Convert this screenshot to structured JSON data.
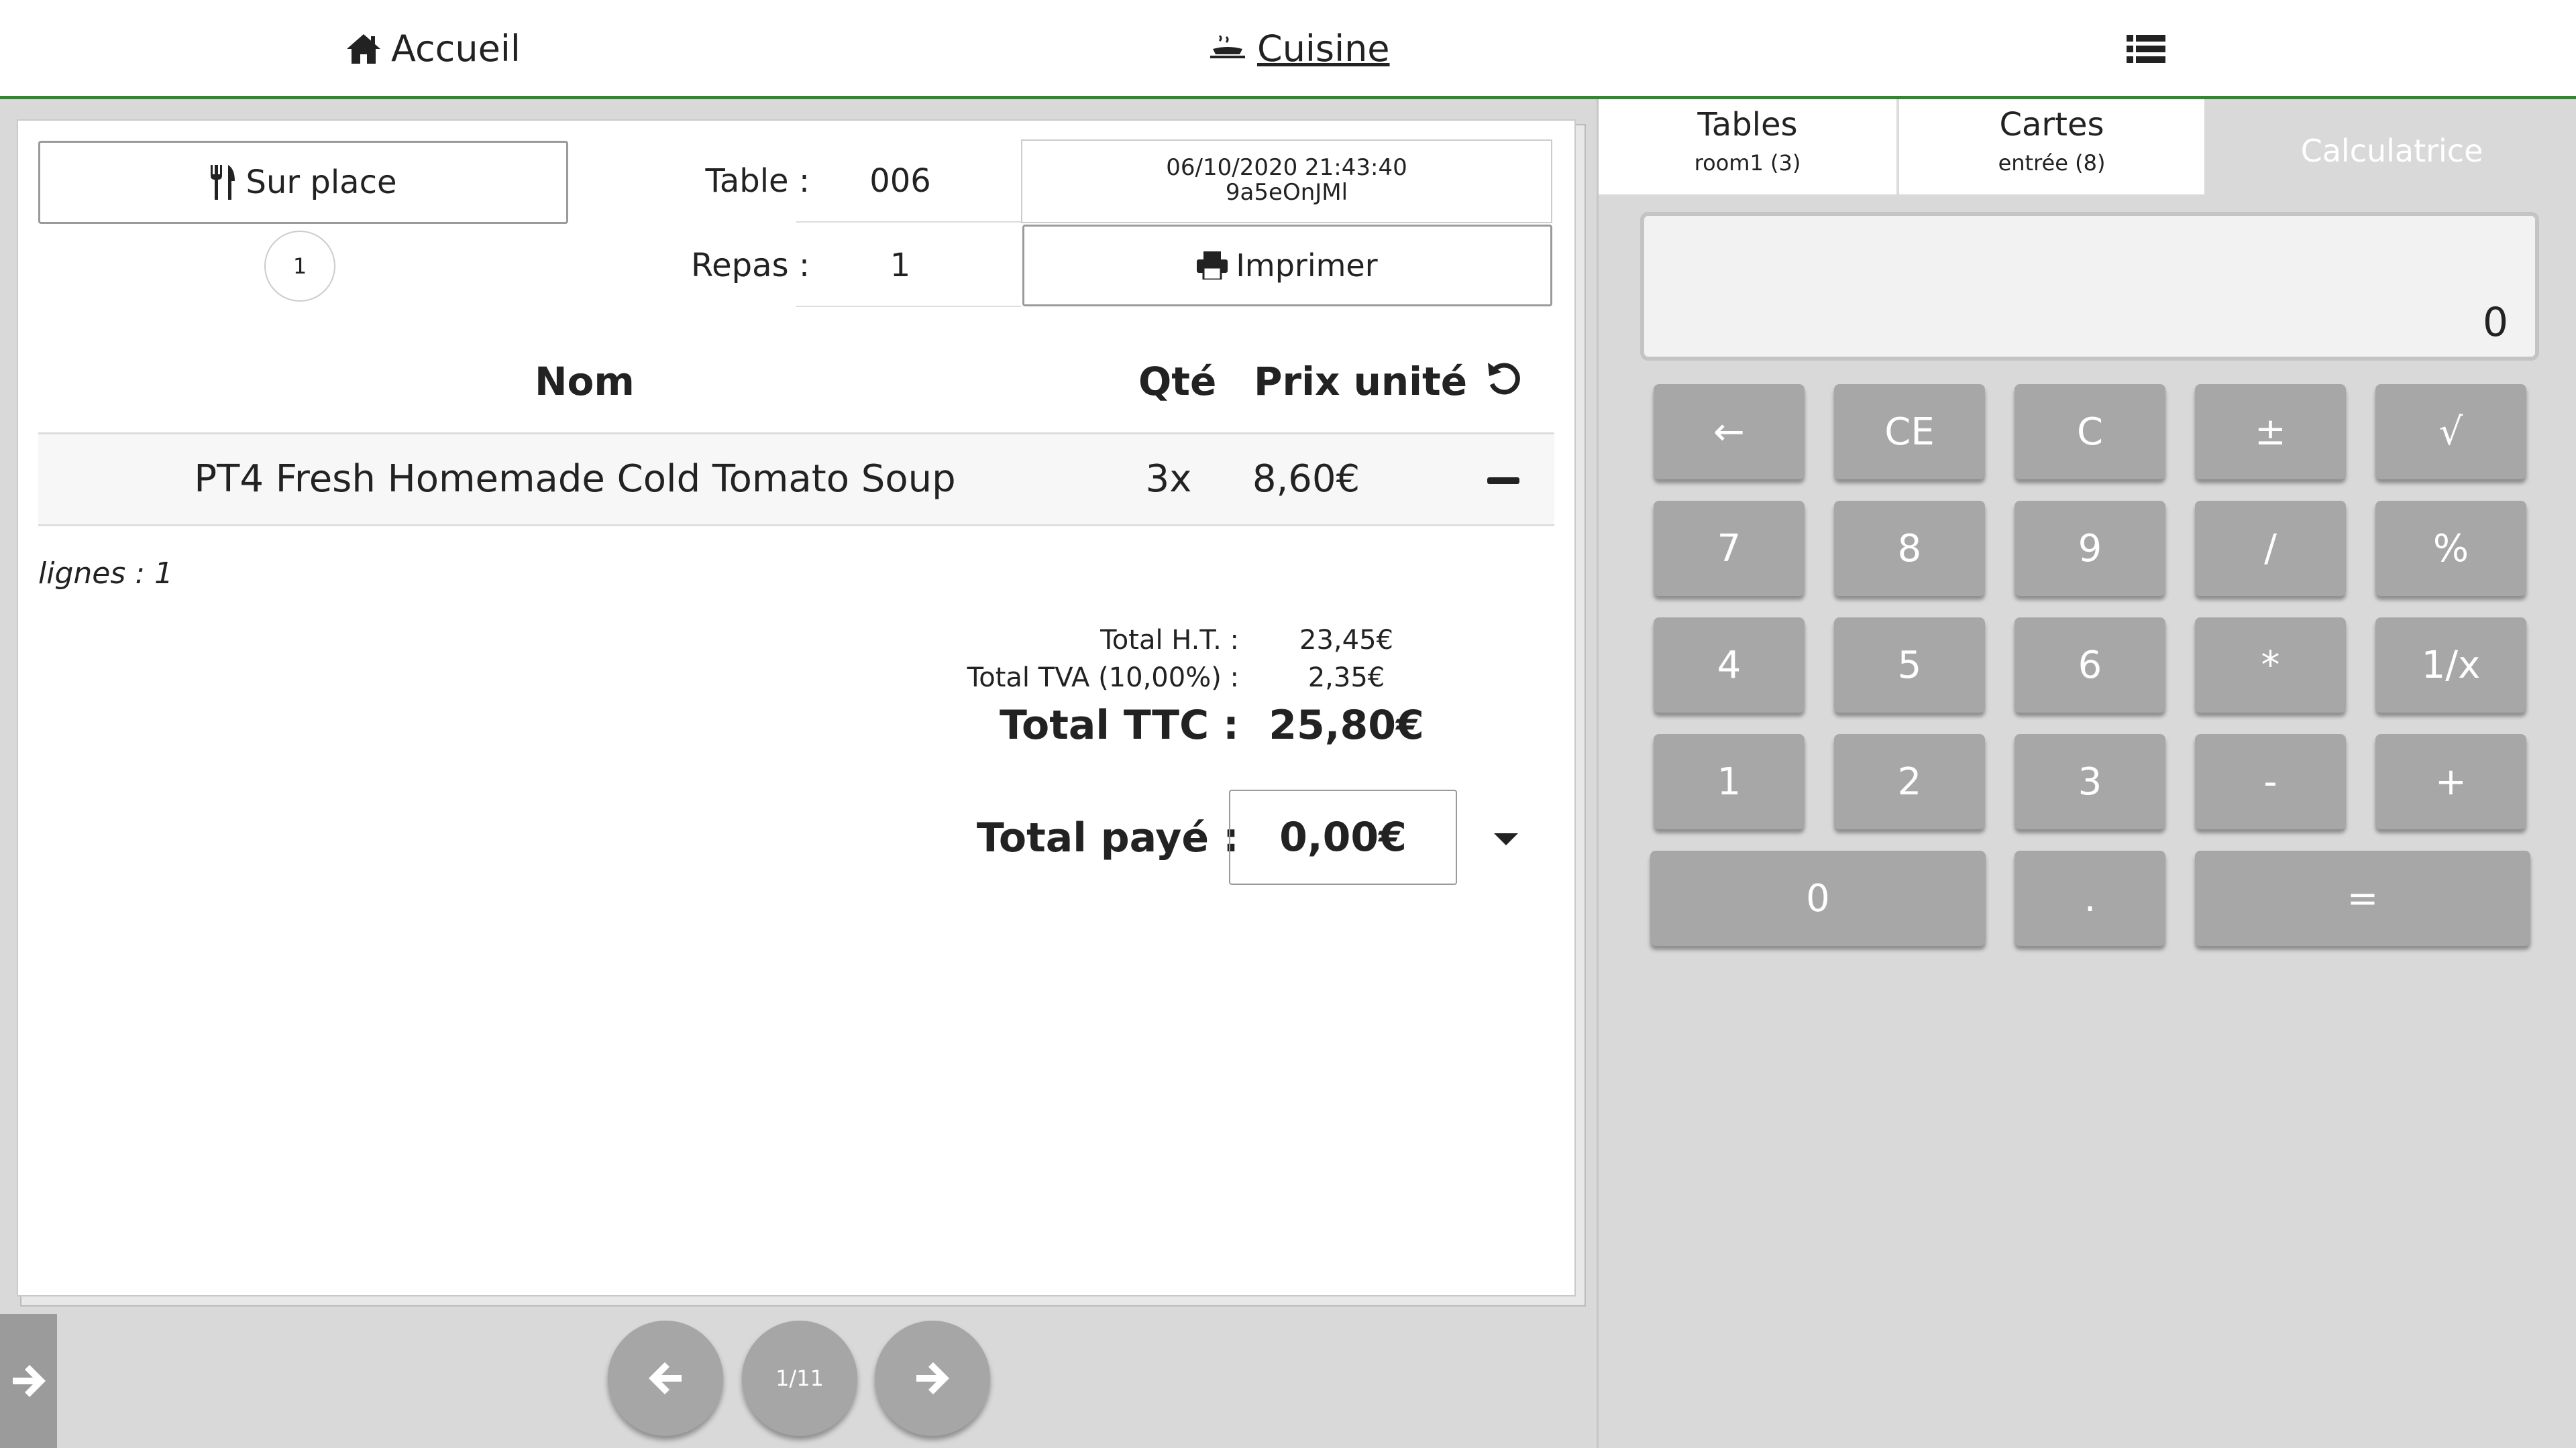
{
  "topbar": {
    "home_label": "Accueil",
    "kitchen_label": "Cuisine",
    "menu_icon": "list-icon"
  },
  "ticket": {
    "service_mode": "Sur place",
    "covers": "1",
    "table_label": "Table :",
    "table_value": "006",
    "meal_label": "Repas :",
    "meal_value": "1",
    "datetime": "06/10/2020 21:43:40",
    "ticket_code": "9a5eOnJMl",
    "print_label": "Imprimer",
    "columns": {
      "name": "Nom",
      "qty": "Qté",
      "unit_price": "Prix unité"
    },
    "lines": [
      {
        "name": "PT4 Fresh Homemade Cold Tomato Soup",
        "qty": "3x",
        "price": "8,60€"
      }
    ],
    "lines_count": "lignes : 1",
    "totals": {
      "ht_label": "Total H.T. :",
      "ht_value": "23,45€",
      "tva_label": "Total TVA (10,00%) :",
      "tva_value": "2,35€",
      "ttc_label": "Total TTC :",
      "ttc_value": "25,80€",
      "paid_label": "Total payé :",
      "paid_value": "0,00€"
    }
  },
  "pager": {
    "page": "1/11"
  },
  "right_panel": {
    "tabs": [
      {
        "title": "Tables",
        "sub": "room1 (3)"
      },
      {
        "title": "Cartes",
        "sub": "entrée (8)"
      },
      {
        "title": "Calculatrice",
        "sub": ""
      }
    ],
    "display": "0",
    "keys": [
      "←",
      "CE",
      "C",
      "±",
      "√",
      "7",
      "8",
      "9",
      "/",
      "%",
      "4",
      "5",
      "6",
      "*",
      "1/x",
      "1",
      "2",
      "3",
      "-",
      "+",
      "0",
      ".",
      "="
    ]
  },
  "colors": {
    "accent_green": "#2f8a2f",
    "key_gray": "#a7a7a7"
  }
}
